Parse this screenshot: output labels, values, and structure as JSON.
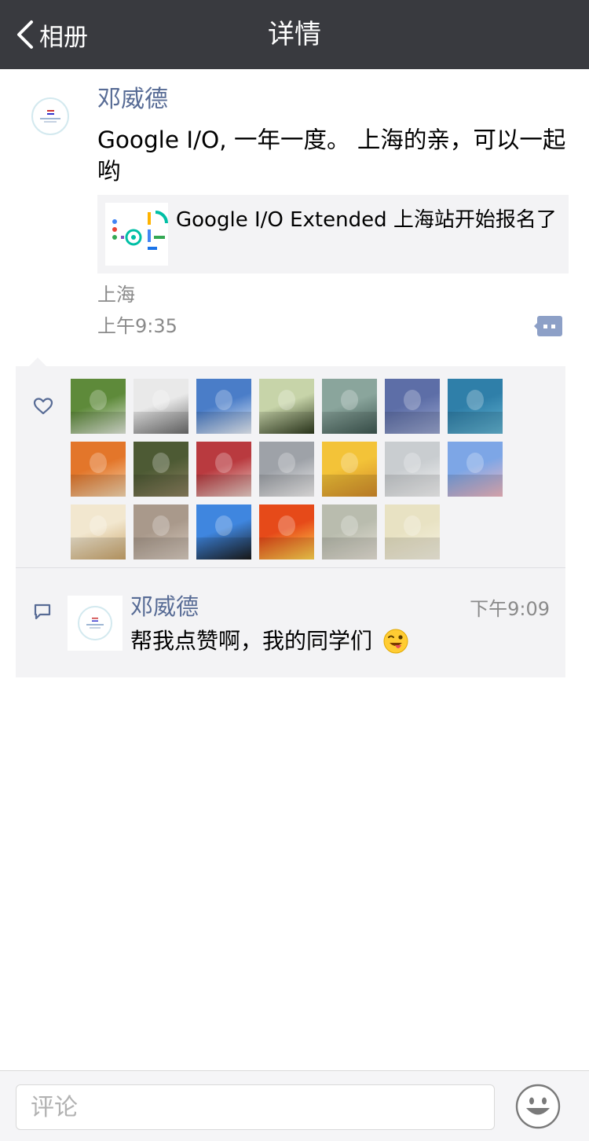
{
  "navbar": {
    "back_label": "相册",
    "title": "详情",
    "bg_color": "#393a3f"
  },
  "post": {
    "author": "邓威德",
    "text": "Google I/O, 一年一度。 上海的亲，可以一起哟",
    "link": {
      "title": "Google I/O Extended 上海站开始报名了"
    },
    "location": "上海",
    "time": "上午9:35",
    "name_color": "#576b95"
  },
  "likes": {
    "icon": "heart-outline-icon",
    "avatars": [
      {
        "top": "#5e8a3a",
        "bottom": "#dfe6d8"
      },
      {
        "top": "#e9e9e9",
        "bottom": "#6b6b6b"
      },
      {
        "top": "#4a7dc8",
        "bottom": "#e8eef6"
      },
      {
        "top": "#c7d4a9",
        "bottom": "#2e3a1e"
      },
      {
        "top": "#8aa59c",
        "bottom": "#3d5650"
      },
      {
        "top": "#5d6ea7",
        "bottom": "#9aa6cf"
      },
      {
        "top": "#2f7fa9",
        "bottom": "#62b3d1"
      },
      {
        "top": "#e3762a",
        "bottom": "#f5d7b0"
      },
      {
        "top": "#4d5a34",
        "bottom": "#8e8260"
      },
      {
        "top": "#b93a3f",
        "bottom": "#e9cfc8"
      },
      {
        "top": "#9ea2a8",
        "bottom": "#f0efef"
      },
      {
        "top": "#f3c338",
        "bottom": "#d18a2a"
      },
      {
        "top": "#c9cdd0",
        "bottom": "#f4f4f4"
      },
      {
        "top": "#7da6e6",
        "bottom": "#f1b7c0"
      },
      {
        "top": "#f2e7cf",
        "bottom": "#c9a46a"
      },
      {
        "top": "#a9998b",
        "bottom": "#d8cbbf"
      },
      {
        "top": "#3f86df",
        "bottom": "#1a1a1a"
      },
      {
        "top": "#e64a19",
        "bottom": "#ffd54f"
      },
      {
        "top": "#b9bcae",
        "bottom": "#e6e1d6"
      },
      {
        "top": "#e8e2c3",
        "bottom": "#f6f2e2"
      }
    ]
  },
  "comment": {
    "icon": "comment-bubble-icon",
    "author": "邓威德",
    "time": "下午9:09",
    "text": "帮我点赞啊，我的同学们",
    "emoji": "wink-tongue-emoji"
  },
  "input": {
    "placeholder": "评论",
    "emoji_button": "smiley-face-icon"
  }
}
